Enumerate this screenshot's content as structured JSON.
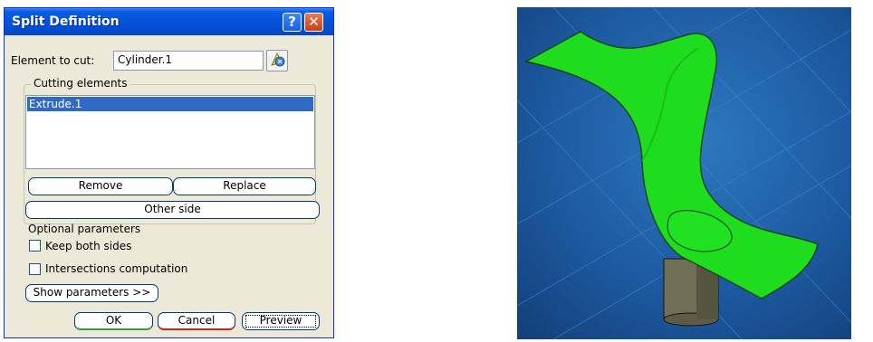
{
  "dialog": {
    "title": "Split Definition",
    "help_label": "?",
    "close_label": "✕",
    "element_to_cut_label": "Element to cut:",
    "element_to_cut_value": "Cylinder.1",
    "cutting_elements_label": "Cutting elements",
    "cutting_elements": [
      "Extrude.1"
    ],
    "remove_label": "Remove",
    "replace_label": "Replace",
    "other_side_label": "Other side",
    "optional_parameters_label": "Optional parameters",
    "keep_both_sides_label": "Keep both sides",
    "keep_both_sides_checked": false,
    "intersections_label": "Intersections computation",
    "intersections_checked": false,
    "show_parameters_label": "Show parameters >>",
    "ok_label": "OK",
    "cancel_label": "Cancel",
    "preview_label": "Preview"
  },
  "viewport": {
    "background_color": "#1d5aa1",
    "surface_color": "#1fdc1f",
    "cylinder_color": "#6f6f55",
    "icons": [
      "split-surface-icon",
      "cylinder-icon"
    ]
  }
}
